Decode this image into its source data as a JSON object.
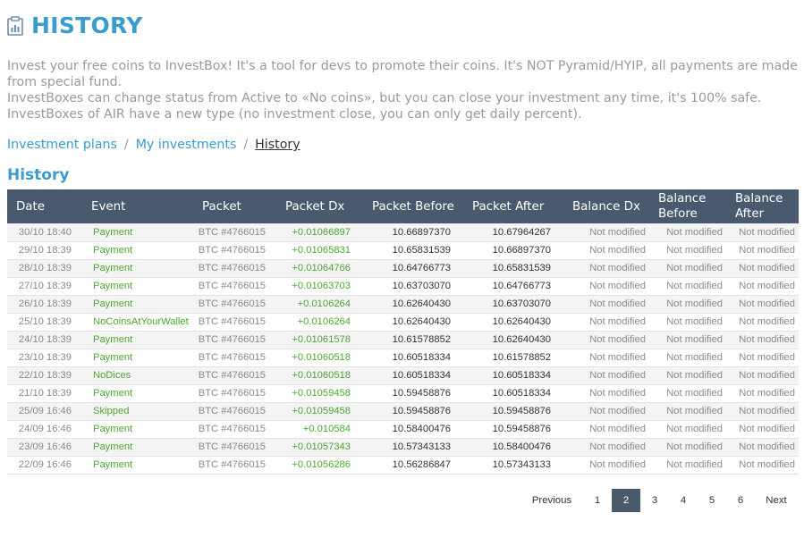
{
  "header": {
    "title": "HISTORY",
    "icon": "chart-icon"
  },
  "intro": [
    "Invest your free coins to InvestBox! It's a tool for devs to promote their coins. It's NOT Pyramid/HYIP, all payments are made from special fund.",
    "InvestBoxes can change status from Active to «No coins», but you can close your investment any time, it's 100% safe.",
    "InvestBoxes of AIR have a new type (no investment close, you can only get daily percent)."
  ],
  "breadcrumb": {
    "item1": "Investment plans",
    "item2": "My investments",
    "current": "History",
    "separator": "/"
  },
  "section_title": "History",
  "table": {
    "columns": [
      "Date",
      "Event",
      "Packet",
      "Packet Dx",
      "Packet Before",
      "Packet After",
      "Balance Dx",
      "Balance Before",
      "Balance After"
    ],
    "rows": [
      [
        "30/10 18:40",
        "Payment",
        "BTC #4766015",
        "+0.01066897",
        "10.66897370",
        "10.67964267",
        "Not modified",
        "Not modified",
        "Not modified"
      ],
      [
        "29/10 18:39",
        "Payment",
        "BTC #4766015",
        "+0.01065831",
        "10.65831539",
        "10.66897370",
        "Not modified",
        "Not modified",
        "Not modified"
      ],
      [
        "28/10 18:39",
        "Payment",
        "BTC #4766015",
        "+0.01064766",
        "10.64766773",
        "10.65831539",
        "Not modified",
        "Not modified",
        "Not modified"
      ],
      [
        "27/10 18:39",
        "Payment",
        "BTC #4766015",
        "+0.01063703",
        "10.63703070",
        "10.64766773",
        "Not modified",
        "Not modified",
        "Not modified"
      ],
      [
        "26/10 18:39",
        "Payment",
        "BTC #4766015",
        "+0.0106264",
        "10.62640430",
        "10.63703070",
        "Not modified",
        "Not modified",
        "Not modified"
      ],
      [
        "25/10 18:39",
        "NoCoinsAtYourWallet",
        "BTC #4766015",
        "+0.0106264",
        "10.62640430",
        "10.62640430",
        "Not modified",
        "Not modified",
        "Not modified"
      ],
      [
        "24/10 18:39",
        "Payment",
        "BTC #4766015",
        "+0.01061578",
        "10.61578852",
        "10.62640430",
        "Not modified",
        "Not modified",
        "Not modified"
      ],
      [
        "23/10 18:39",
        "Payment",
        "BTC #4766015",
        "+0.01060518",
        "10.60518334",
        "10.61578852",
        "Not modified",
        "Not modified",
        "Not modified"
      ],
      [
        "22/10 18:39",
        "NoDices",
        "BTC #4766015",
        "+0.01060518",
        "10.60518334",
        "10.60518334",
        "Not modified",
        "Not modified",
        "Not modified"
      ],
      [
        "21/10 18:39",
        "Payment",
        "BTC #4766015",
        "+0.01059458",
        "10.59458876",
        "10.60518334",
        "Not modified",
        "Not modified",
        "Not modified"
      ],
      [
        "25/09 16:46",
        "Skipped",
        "BTC #4766015",
        "+0.01059458",
        "10.59458876",
        "10.59458876",
        "Not modified",
        "Not modified",
        "Not modified"
      ],
      [
        "24/09 16:46",
        "Payment",
        "BTC #4766015",
        "+0.010584",
        "10.58400476",
        "10.59458876",
        "Not modified",
        "Not modified",
        "Not modified"
      ],
      [
        "23/09 16:46",
        "Payment",
        "BTC #4766015",
        "+0.01057343",
        "10.57343133",
        "10.58400476",
        "Not modified",
        "Not modified",
        "Not modified"
      ],
      [
        "22/09 16:46",
        "Payment",
        "BTC #4766015",
        "+0.01056286",
        "10.56286847",
        "10.57343133",
        "Not modified",
        "Not modified",
        "Not modified"
      ]
    ]
  },
  "pagination": {
    "previous": "Previous",
    "pages": [
      "1",
      "2",
      "3",
      "4",
      "5",
      "6"
    ],
    "active_page": "2",
    "next": "Next"
  },
  "colors": {
    "accent": "#3a9bce",
    "header_bg": "#4a5a6e",
    "positive": "#4ba832",
    "muted": "#8a8a8a"
  }
}
